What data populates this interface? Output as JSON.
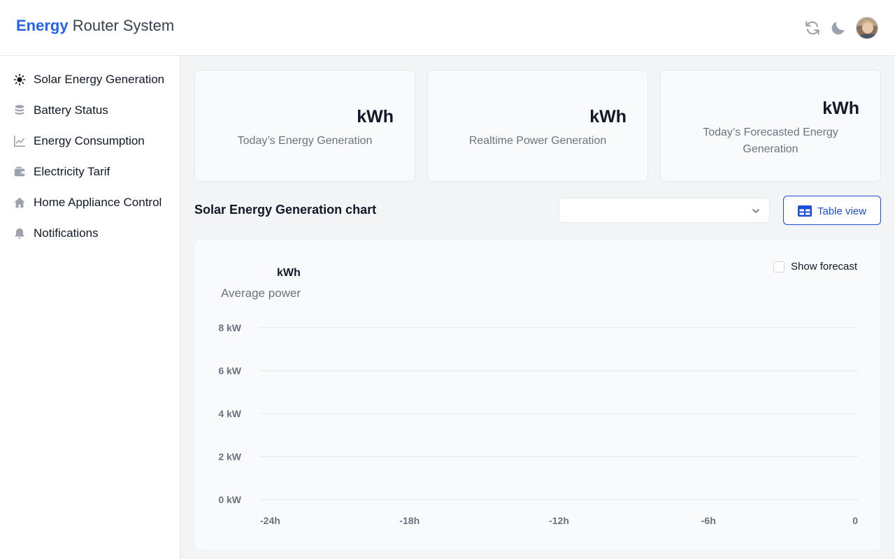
{
  "header": {
    "brand_bold": "Energy",
    "brand_rest": "Router System",
    "icons": [
      "refresh-icon",
      "moon-icon"
    ],
    "avatar_alt": "user avatar"
  },
  "sidebar": {
    "items": [
      {
        "label": "Solar Energy Generation",
        "icon": "sun-icon"
      },
      {
        "label": "Battery Status",
        "icon": "database-icon"
      },
      {
        "label": "Energy Consumption",
        "icon": "chart-line-icon"
      },
      {
        "label": "Electricity Tarif",
        "icon": "wallet-icon"
      },
      {
        "label": "Home Appliance Control",
        "icon": "home-icon"
      },
      {
        "label": "Notifications",
        "icon": "bell-icon"
      }
    ]
  },
  "cards": [
    {
      "value": "kWh",
      "caption": "Today’s Energy Generation"
    },
    {
      "value": "kWh",
      "caption": "Realtime Power Generation"
    },
    {
      "value": "kWh",
      "caption": "Today’s Forecasted Energy Generation"
    }
  ],
  "chart_section": {
    "title": "Solar Energy Generation chart",
    "select_value": "",
    "table_view_label": "Table view",
    "avg_value": "kWh",
    "avg_caption": "Average power",
    "show_forecast_label": "Show forecast",
    "show_forecast_checked": false
  },
  "colors": {
    "accent": "#2563eb",
    "accent_dark": "#1d4ed8",
    "text": "#111827",
    "muted": "#6b7280",
    "icon": "#9ca3af"
  },
  "chart_data": {
    "type": "line",
    "title": "",
    "xlabel": "",
    "ylabel": "",
    "x_ticks": [
      "-24h",
      "-18h",
      "-12h",
      "-6h",
      "0"
    ],
    "y_ticks": [
      "0 kW",
      "2 kW",
      "4 kW",
      "6 kW",
      "8 kW"
    ],
    "ylim": [
      0,
      8
    ],
    "xlim": [
      -24,
      0
    ],
    "grid": true,
    "series": []
  }
}
